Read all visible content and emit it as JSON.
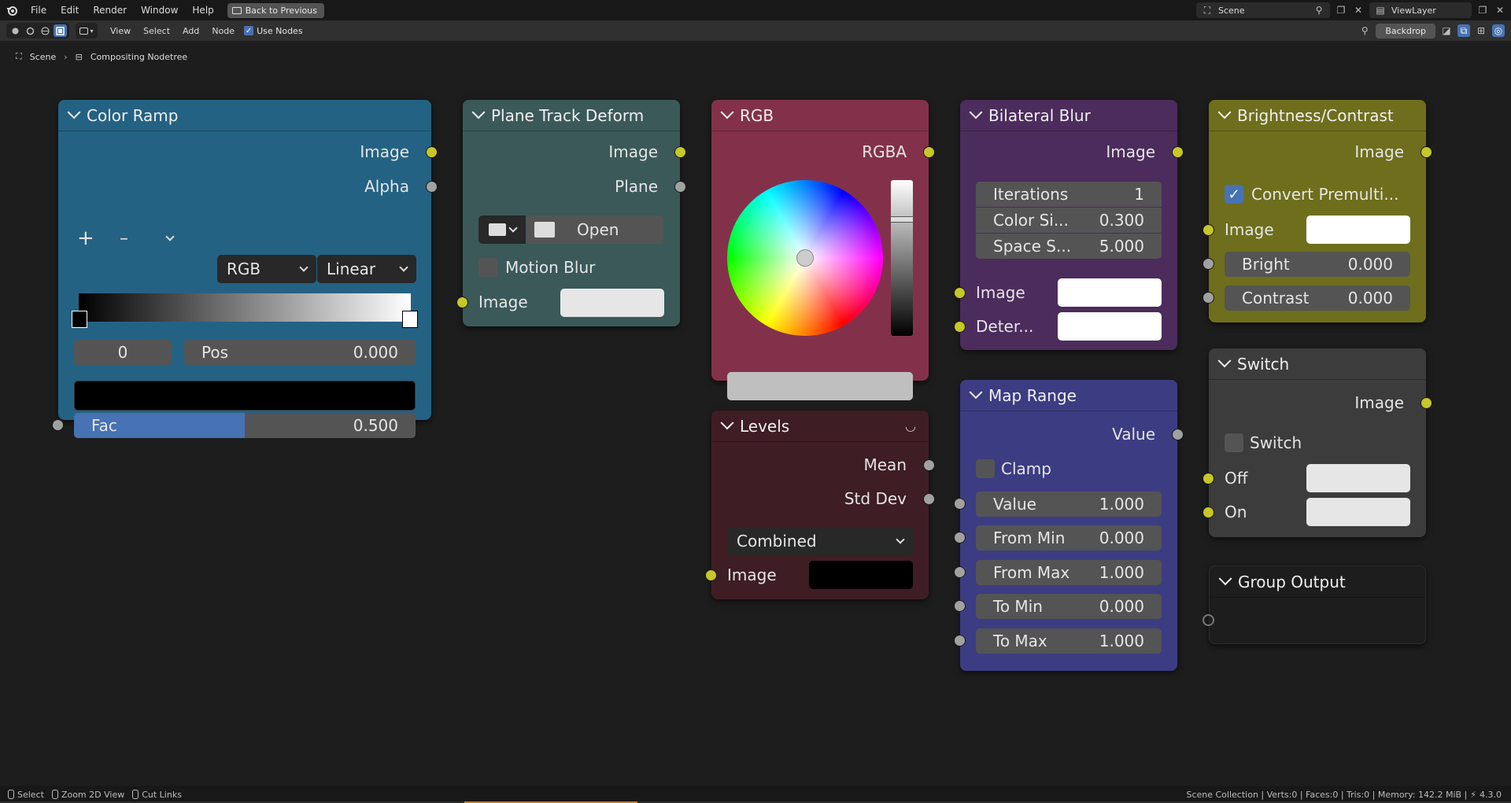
{
  "topbar": {
    "menus": [
      "File",
      "Edit",
      "Render",
      "Window",
      "Help"
    ],
    "back_label": "Back to Previous",
    "scene_name": "Scene",
    "view_layer": "ViewLayer"
  },
  "editor_header": {
    "menus": [
      "View",
      "Select",
      "Add",
      "Node"
    ],
    "use_nodes_label": "Use Nodes",
    "backdrop_label": "Backdrop"
  },
  "breadcrumb": {
    "scene": "Scene",
    "tree": "Compositing Nodetree"
  },
  "nodes": {
    "color_ramp": {
      "title": "Color Ramp",
      "out_image": "Image",
      "out_alpha": "Alpha",
      "add": "+",
      "remove": "–",
      "mode": "RGB",
      "interp": "Linear",
      "stop_index": "0",
      "pos_label": "Pos",
      "pos_value": "0.000",
      "fac_label": "Fac",
      "fac_value": "0.500",
      "fac_fraction": 0.5,
      "header_color": "#246283"
    },
    "plane_track": {
      "title": "Plane Track Deform",
      "out_image": "Image",
      "out_plane": "Plane",
      "open_label": "Open",
      "motion_blur": "Motion Blur",
      "in_image": "Image",
      "header_color": "#3b5959"
    },
    "rgb": {
      "title": "RGB",
      "out_rgba": "RGBA",
      "header_color": "#83314a"
    },
    "bilateral": {
      "title": "Bilateral Blur",
      "out_image": "Image",
      "iterations_label": "Iterations",
      "iterations_value": "1",
      "color_sigma_label": "Color Si...",
      "color_sigma_value": "0.300",
      "space_sigma_label": "Space S...",
      "space_sigma_value": "5.000",
      "in_image": "Image",
      "in_determinator": "Deter...",
      "header_color": "#4c2c5c"
    },
    "brightness": {
      "title": "Brightness/Contrast",
      "out_image": "Image",
      "convert_label": "Convert Premulti...",
      "in_image": "Image",
      "bright_label": "Bright",
      "bright_value": "0.000",
      "contrast_label": "Contrast",
      "contrast_value": "0.000",
      "header_color": "#6e6e1d"
    },
    "levels": {
      "title": "Levels",
      "out_mean": "Mean",
      "out_std": "Std Dev",
      "channel": "Combined",
      "in_image": "Image",
      "header_color": "#3f1d25"
    },
    "map_range": {
      "title": "Map Range",
      "out_value": "Value",
      "clamp_label": "Clamp",
      "value_label": "Value",
      "value_value": "1.000",
      "from_min_label": "From Min",
      "from_min_value": "0.000",
      "from_max_label": "From Max",
      "from_max_value": "1.000",
      "to_min_label": "To Min",
      "to_min_value": "0.000",
      "to_max_label": "To Max",
      "to_max_value": "1.000",
      "header_color": "#3c3c83"
    },
    "switch": {
      "title": "Switch",
      "out_image": "Image",
      "switch_label": "Switch",
      "off_label": "Off",
      "on_label": "On",
      "header_color": "#3c3c3c"
    },
    "group_output": {
      "title": "Group Output",
      "header_color": "#1d1d1d"
    }
  },
  "statusbar": {
    "select": "Select",
    "zoom": "Zoom 2D View",
    "cut": "Cut Links",
    "stats": "Scene Collection | Verts:0 | Faces:0 | Tris:0 | Memory: 142.2 MiB |",
    "version": "4.3.0"
  }
}
